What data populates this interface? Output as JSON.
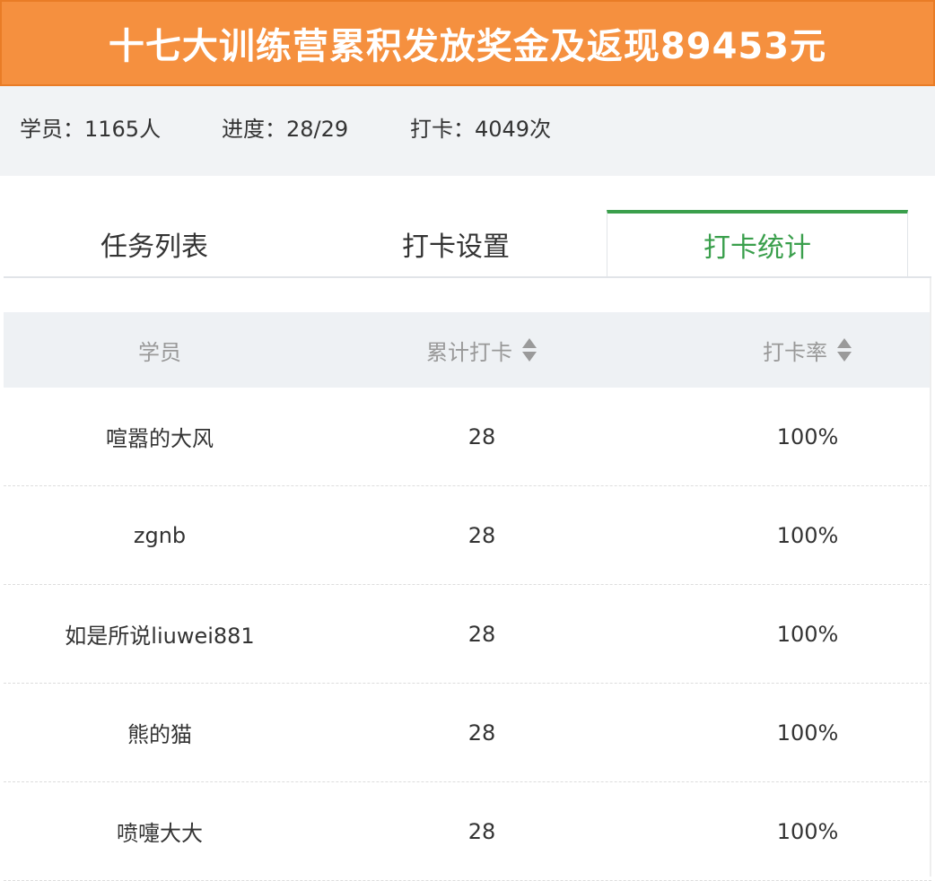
{
  "banner": {
    "title": "十七大训练营累积发放奖金及返现89453元"
  },
  "stats": {
    "students": "学员：1165人",
    "progress": "进度：28/29",
    "checkins": "打卡：4049次"
  },
  "tabs": [
    {
      "label": "任务列表",
      "active": false
    },
    {
      "label": "打卡设置",
      "active": false
    },
    {
      "label": "打卡统计",
      "active": true
    }
  ],
  "table": {
    "headers": [
      "学员",
      "累计打卡",
      "打卡率"
    ],
    "rows": [
      {
        "name": "喧嚣的大风",
        "count": "28",
        "rate": "100%"
      },
      {
        "name": "zgnb",
        "count": "28",
        "rate": "100%"
      },
      {
        "name": "如是所说liuwei881",
        "count": "28",
        "rate": "100%"
      },
      {
        "name": "熊的猫",
        "count": "28",
        "rate": "100%"
      },
      {
        "name": "喷嚏大大",
        "count": "28",
        "rate": "100%"
      }
    ]
  },
  "colors": {
    "banner": "#f5903f",
    "active_tab": "#3a9f4c",
    "header_bg": "#eef1f4",
    "stats_bg": "#f1f3f5"
  },
  "icons": {
    "sort": "sort-updown-icon"
  }
}
